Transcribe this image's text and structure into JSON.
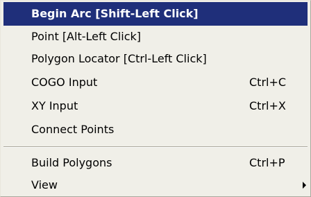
{
  "menu": {
    "items": [
      {
        "label": "Begin Arc [Shift-Left Click]",
        "shortcut": "",
        "selected": true
      },
      {
        "label": "Point  [Alt-Left Click]",
        "shortcut": ""
      },
      {
        "label": "Polygon Locator [Ctrl-Left Click]",
        "shortcut": ""
      },
      {
        "label": "COGO Input",
        "shortcut": "Ctrl+C"
      },
      {
        "label": "XY Input",
        "shortcut": "Ctrl+X"
      },
      {
        "label": "Connect Points",
        "shortcut": ""
      },
      {
        "label": "Build Polygons",
        "shortcut": "Ctrl+P"
      },
      {
        "label": "View",
        "shortcut": "",
        "submenu_icon": "submenu-arrow-icon"
      }
    ]
  },
  "colors": {
    "menu_background": "#f0efe8",
    "highlight": "#1f2f7a",
    "highlight_text": "#ffffff",
    "text": "#000000"
  }
}
